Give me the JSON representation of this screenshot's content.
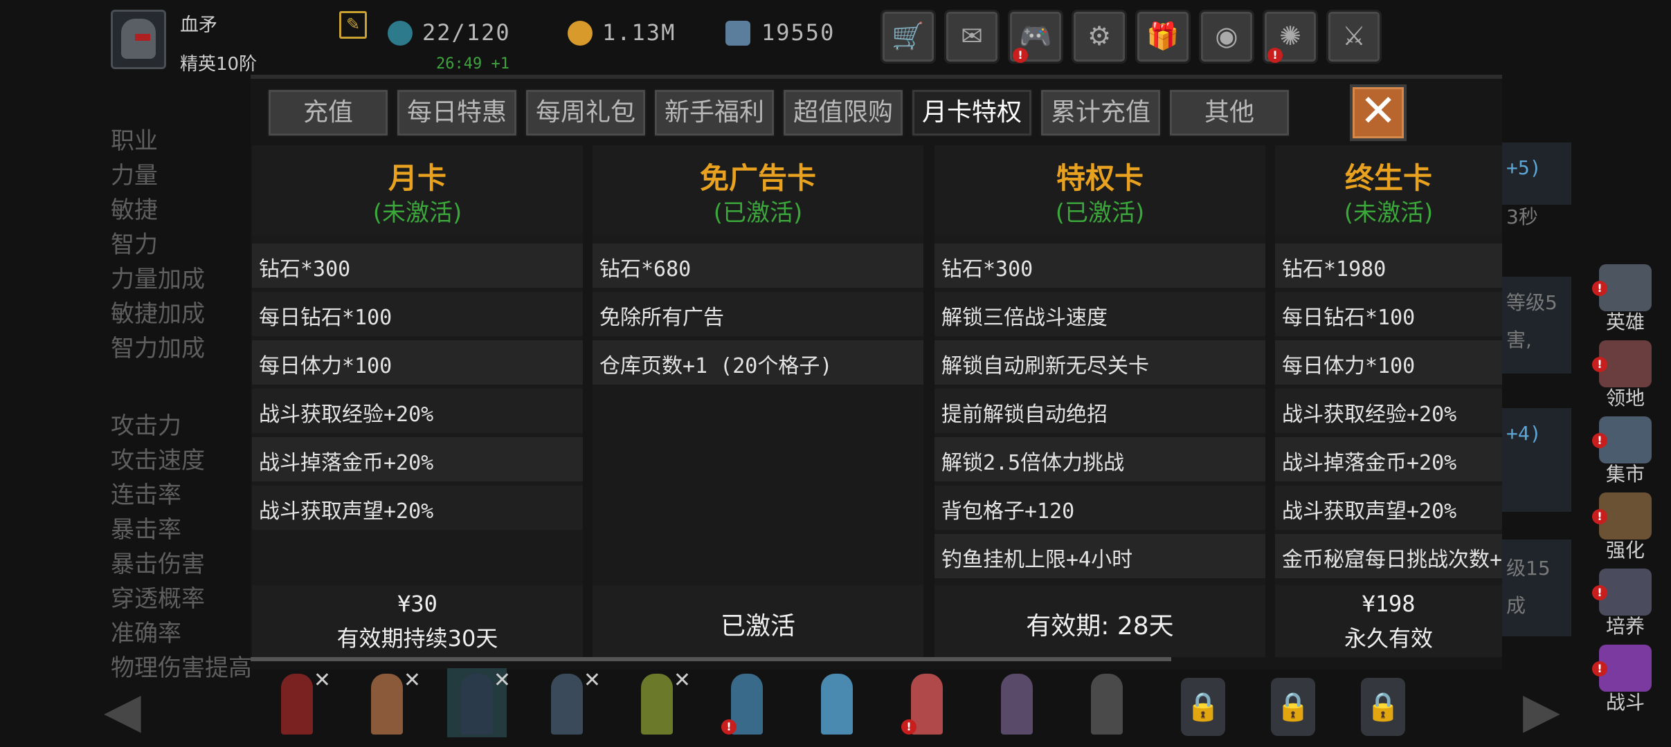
{
  "player": {
    "name": "血矛",
    "rank": "精英10阶"
  },
  "resources": {
    "stamina": "22/120",
    "stamina_timer": "26:49 +1",
    "gold": "1.13M",
    "diamonds": "19550"
  },
  "toolbar": [
    {
      "icon": "cart-icon",
      "glyph": "🛒",
      "badge": false
    },
    {
      "icon": "mail-icon",
      "glyph": "✉",
      "badge": false
    },
    {
      "icon": "gamepad-icon",
      "glyph": "🎮",
      "badge": true
    },
    {
      "icon": "gear-icon",
      "glyph": "⚙",
      "badge": false
    },
    {
      "icon": "gift-icon",
      "glyph": "🎁",
      "badge": false
    },
    {
      "icon": "color-wheel-icon",
      "glyph": "◉",
      "badge": false
    },
    {
      "icon": "firework-icon",
      "glyph": "✺",
      "badge": true
    },
    {
      "icon": "swords-icon",
      "glyph": "⚔",
      "badge": false
    }
  ],
  "stats_bg": [
    "职业",
    "力量",
    "敏捷",
    "智力",
    "力量加成",
    "敏捷加成",
    "智力加成",
    "攻击力",
    "攻击速度",
    "连击率",
    "暴击率",
    "暴击伤害",
    "穿透概率",
    "准确率",
    "物理伤害提高"
  ],
  "tabs": [
    "充值",
    "每日特惠",
    "每周礼包",
    "新手福利",
    "超值限购",
    "月卡特权",
    "累计充值",
    "其他"
  ],
  "active_tab": "月卡特权",
  "cards": [
    {
      "title": "月卡",
      "status": "(未激活)",
      "items": [
        "钻石*300",
        "每日钻石*100",
        "每日体力*100",
        "战斗获取经验+20%",
        "战斗掉落金币+20%",
        "战斗获取声望+20%"
      ],
      "price": "¥30",
      "footer": "有效期持续30天"
    },
    {
      "title": "免广告卡",
      "status": "(已激活)",
      "items": [
        "钻石*680",
        "免除所有广告",
        "仓库页数+1 (20个格子)"
      ],
      "footer": "已激活"
    },
    {
      "title": "特权卡",
      "status": "(已激活)",
      "items": [
        "钻石*300",
        "解锁三倍战斗速度",
        "解锁自动刷新无尽关卡",
        "提前解锁自动绝招",
        "解锁2.5倍体力挑战",
        "背包格子+120",
        "钓鱼挂机上限+4小时"
      ],
      "footer": "有效期: 28天"
    },
    {
      "title": "终生卡",
      "status": "(未激活)",
      "items": [
        "钻石*1980",
        "每日钻石*100",
        "每日体力*100",
        "战斗获取经验+20%",
        "战斗掉落金币+20%",
        "战斗获取声望+20%",
        "金币秘窟每日挑战次数+"
      ],
      "price": "¥198",
      "footer": "永久有效"
    }
  ],
  "right_partial": [
    "+5)",
    "3秒",
    "等级5",
    "害,",
    "+4)",
    "级15",
    "成"
  ],
  "right_nav": [
    "英雄",
    "领地",
    "集市",
    "强化",
    "培养",
    "战斗"
  ],
  "colors": {
    "gold_title": "#e8a21f",
    "status_green": "#3aa83a",
    "close_orange": "#b9652e"
  }
}
